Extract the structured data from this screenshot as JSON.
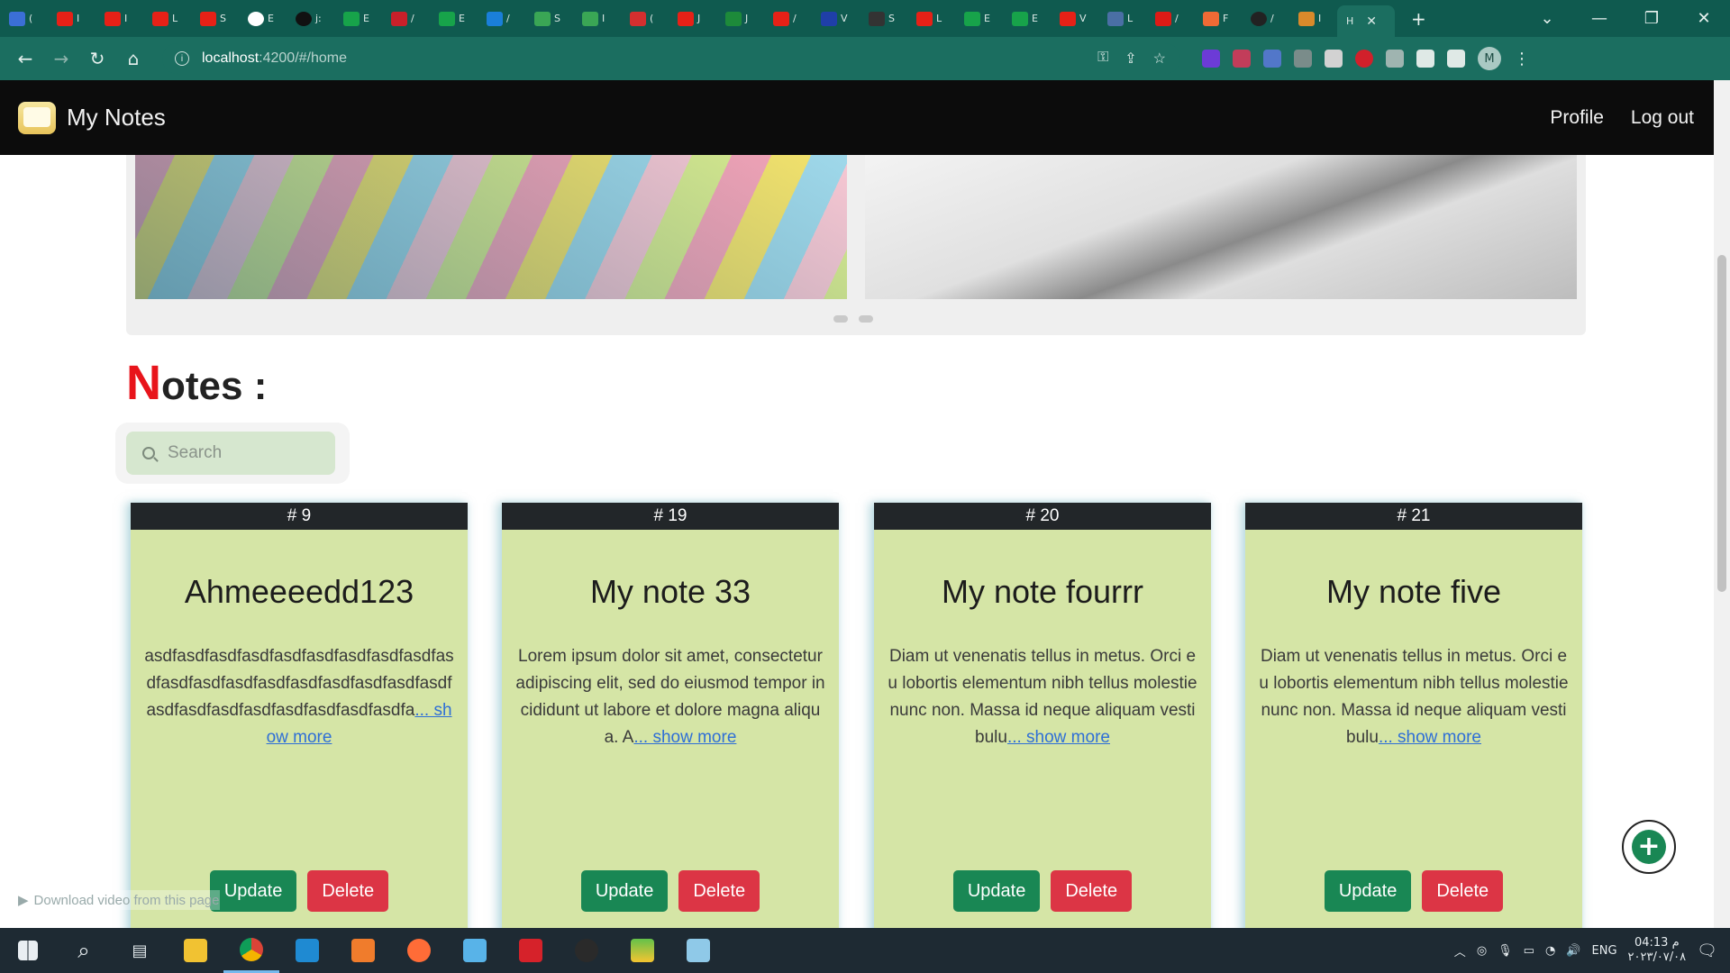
{
  "browser": {
    "url_host": "localhost",
    "url_path": ":4200/#/home",
    "tab_labels": [
      "(",
      "I",
      "I",
      "L",
      "S",
      "E",
      "j:",
      "E",
      "/",
      "E",
      "/",
      "S",
      "I",
      "(",
      "J",
      "J",
      "/",
      "V",
      "S",
      "L",
      "E",
      "E",
      "V",
      "L",
      "/",
      "F",
      "/",
      "I",
      "H"
    ]
  },
  "app": {
    "brand": "My Notes",
    "nav_profile": "Profile",
    "nav_logout": "Log out"
  },
  "section": {
    "title_cap": "N",
    "title_rest": "otes :",
    "search_placeholder": "Search"
  },
  "notes": [
    {
      "id": "# 9",
      "title": "Ahmeeeedd123",
      "body": "asdfasdfasdfasdfasdfasdfasdfasdfasdfasdfasdfasdfasdfasdfasdfasdfasdfasdfasdfasdfasdfasdfasdfasdfasdfasdfasdfa",
      "more": "... show more",
      "update": "Update",
      "delete": "Delete"
    },
    {
      "id": "# 19",
      "title": "My note 33",
      "body": "Lorem ipsum dolor sit amet, consectetur adipiscing elit, sed do eiusmod tempor incididunt ut labore et dolore magna aliqua. A",
      "more": "... show more",
      "update": "Update",
      "delete": "Delete"
    },
    {
      "id": "# 20",
      "title": "My note fourrr",
      "body": "Diam ut venenatis tellus in metus. Orci eu lobortis elementum nibh tellus molestie nunc non. Massa id neque aliquam vestibulu",
      "more": "... show more",
      "update": "Update",
      "delete": "Delete"
    },
    {
      "id": "# 21",
      "title": "My note five",
      "body": "Diam ut venenatis tellus in metus. Orci eu lobortis elementum nibh tellus molestie nunc non. Massa id neque aliquam vestibulu",
      "more": "... show more",
      "update": "Update",
      "delete": "Delete"
    }
  ],
  "overlay": {
    "download_text": "Download video from this page"
  },
  "taskbar": {
    "lang": "ENG",
    "time": "04:13 م",
    "date": "٢٠٢٣/٠٧/٠٨"
  },
  "colors": {
    "accent_red": "#e8141b",
    "card_bg": "#d5e5a6",
    "update_green": "#198754",
    "delete_red": "#dc3545"
  }
}
